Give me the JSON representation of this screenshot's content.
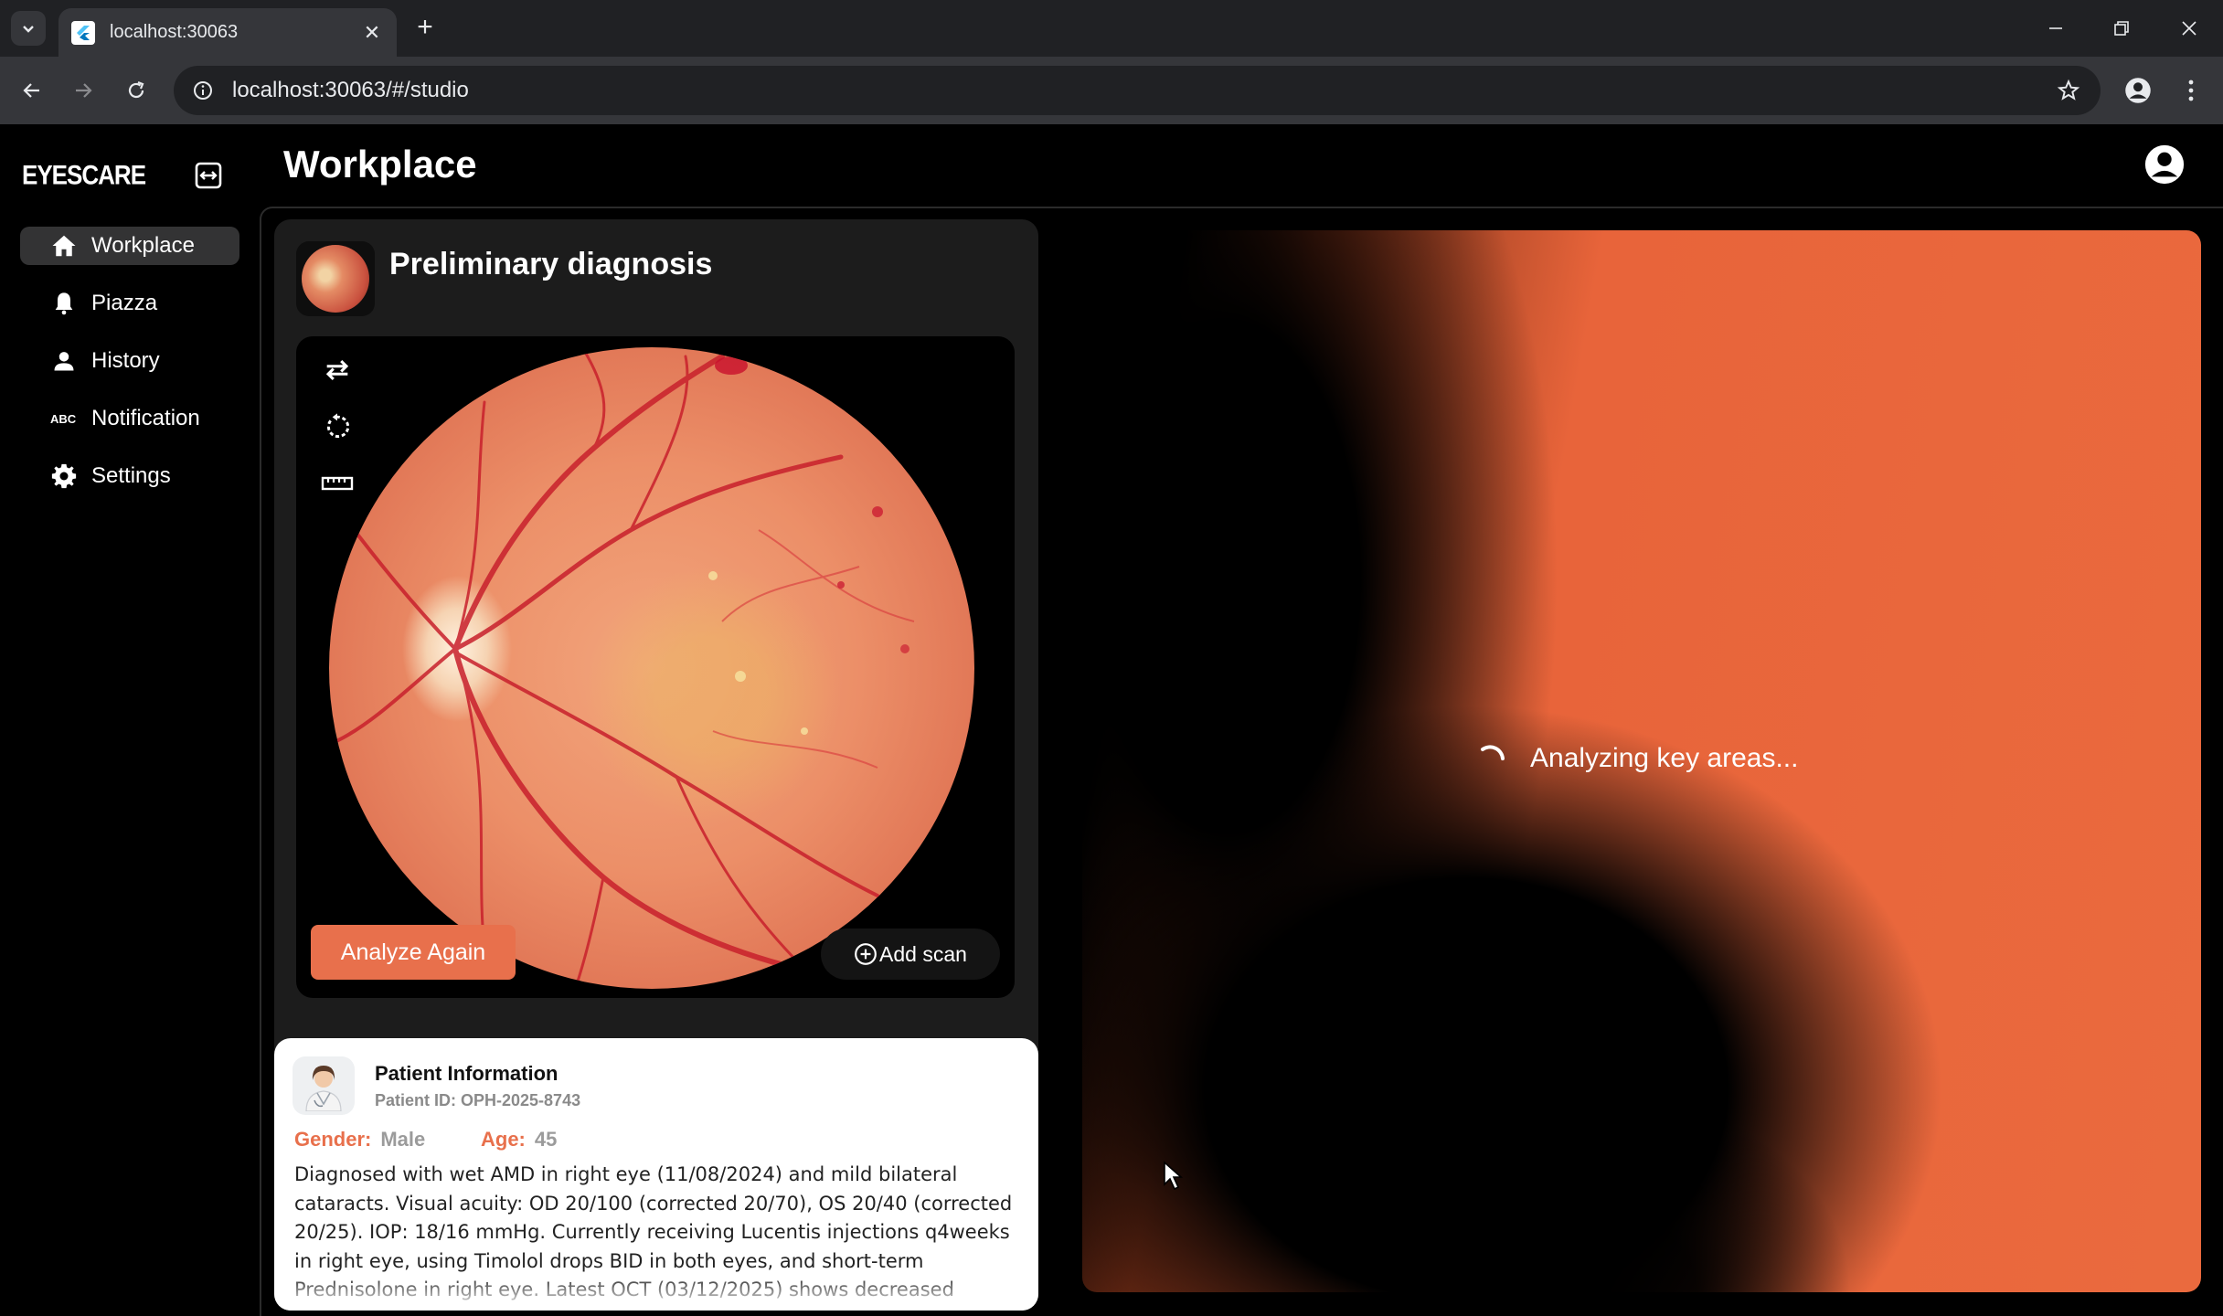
{
  "browser": {
    "tab_title": "localhost:30063",
    "url": "localhost:30063/#/studio"
  },
  "app": {
    "logo": "EYESCARE",
    "page_title": "Workplace"
  },
  "sidebar": {
    "items": [
      {
        "label": "Workplace",
        "icon": "home-icon",
        "active": true
      },
      {
        "label": "Piazza",
        "icon": "bell-icon",
        "active": false
      },
      {
        "label": "History",
        "icon": "person-icon",
        "active": false
      },
      {
        "label": "Notification",
        "icon": "abc-icon",
        "active": false
      },
      {
        "label": "Settings",
        "icon": "gear-icon",
        "active": false
      }
    ]
  },
  "diagnosis": {
    "title": "Preliminary diagnosis",
    "tools": [
      "swap-icon",
      "rotate-icon",
      "ruler-icon"
    ],
    "analyze_label": "Analyze Again",
    "add_scan_label": "Add scan"
  },
  "patient": {
    "title": "Patient Information",
    "id": "Patient ID: OPH-2025-8743",
    "gender_key": "Gender:",
    "gender": "Male",
    "age_key": "Age:",
    "age": "45",
    "notes": "Diagnosed with wet AMD in right eye (11/08/2024) and mild bilateral cataracts. Visual acuity: OD 20/100 (corrected 20/70), OS 20/40 (corrected 20/25). IOP: 18/16 mmHg. Currently receiving Lucentis injections q4weeks in right eye, using Timolol drops BID in both eyes, and short-term Prednisolone in right eye. Latest OCT (03/12/2025) shows decreased"
  },
  "analysis": {
    "status": "Analyzing key areas..."
  },
  "colors": {
    "accent": "#e8704c",
    "panel": "#1c1c1c",
    "active_nav": "#333334"
  }
}
